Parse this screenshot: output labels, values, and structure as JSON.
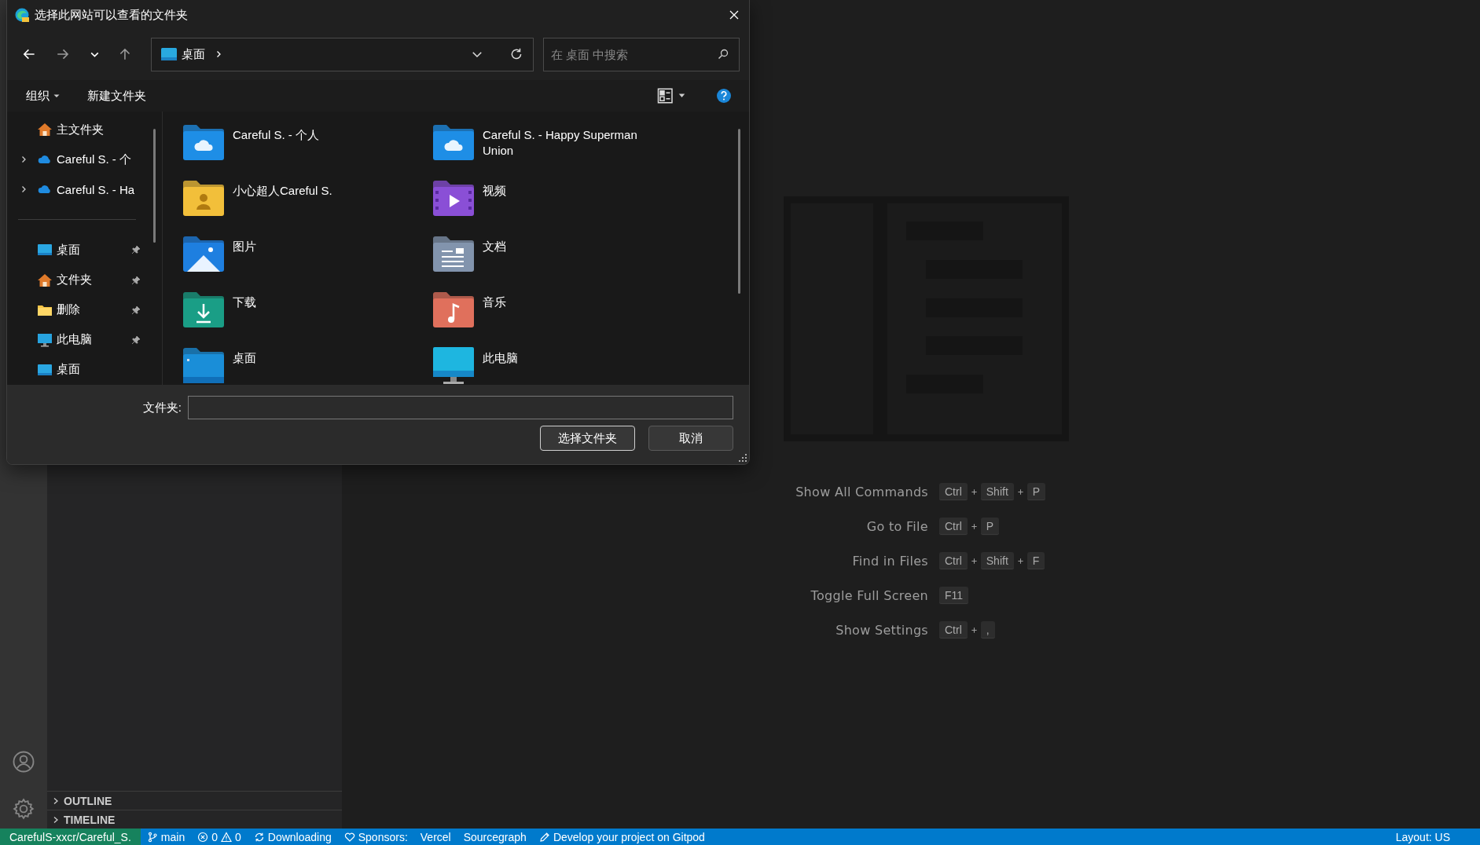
{
  "dialog": {
    "title": "选择此网站可以查看的文件夹",
    "address": {
      "location": "桌面"
    },
    "search": {
      "placeholder": "在 桌面 中搜索"
    },
    "toolbar": [
      "组织",
      "新建文件夹"
    ],
    "nav_pane": [
      {
        "label": "主文件夹",
        "kind": "home",
        "expandable": false,
        "pinned": false
      },
      {
        "label": "Careful S. - 个",
        "kind": "cloud",
        "expandable": true,
        "pinned": false
      },
      {
        "label": "Careful S. - Ha",
        "kind": "cloud",
        "expandable": true,
        "pinned": false
      },
      {
        "kind": "separator"
      },
      {
        "label": "桌面",
        "kind": "desktop",
        "expandable": false,
        "pinned": true
      },
      {
        "label": "文件夹",
        "kind": "home",
        "expandable": false,
        "pinned": true
      },
      {
        "label": "删除",
        "kind": "folder",
        "expandable": false,
        "pinned": true
      },
      {
        "label": "此电脑",
        "kind": "pc",
        "expandable": false,
        "pinned": true
      },
      {
        "label": "桌面",
        "kind": "desktop",
        "expandable": false,
        "pinned": false
      }
    ],
    "folders": [
      {
        "label": "Careful S. - 个人",
        "kind": "cloud"
      },
      {
        "label": "Careful S. - Happy Superman Union",
        "kind": "cloud"
      },
      {
        "label": "小心超人Careful S.",
        "kind": "user"
      },
      {
        "label": "视频",
        "kind": "video"
      },
      {
        "label": "图片",
        "kind": "pictures"
      },
      {
        "label": "文档",
        "kind": "documents"
      },
      {
        "label": "下载",
        "kind": "downloads"
      },
      {
        "label": "音乐",
        "kind": "music"
      },
      {
        "label": "桌面",
        "kind": "desktop"
      },
      {
        "label": "此电脑",
        "kind": "pc"
      }
    ],
    "folder_field": {
      "label": "文件夹:"
    },
    "buttons": [
      "选择文件夹",
      "取消"
    ]
  },
  "sidebar_sections": [
    {
      "label": "OUTLINE",
      "expanded": false
    },
    {
      "label": "TIMELINE",
      "expanded": false
    }
  ],
  "shortcuts": [
    {
      "label": "Show All Commands",
      "keys": [
        "Ctrl",
        "Shift",
        "P"
      ]
    },
    {
      "label": "Go to File",
      "keys": [
        "Ctrl",
        "P"
      ]
    },
    {
      "label": "Find in Files",
      "keys": [
        "Ctrl",
        "Shift",
        "F"
      ]
    },
    {
      "label": "Toggle Full Screen",
      "keys": [
        "F11"
      ]
    },
    {
      "label": "Show Settings",
      "keys": [
        "Ctrl",
        ","
      ]
    }
  ],
  "status_bar": {
    "remote": "CarefulS-xxcr/Careful_S.",
    "items": [
      {
        "kind": "branch",
        "text": "main"
      },
      {
        "kind": "problems",
        "errors": "0",
        "warnings": "0"
      },
      {
        "kind": "sync",
        "text": "Downloading"
      },
      {
        "kind": "heart",
        "text": "Sponsors:"
      },
      {
        "kind": "plain",
        "text": "Vercel"
      },
      {
        "kind": "plain",
        "text": "Sourcegraph"
      },
      {
        "kind": "pencil",
        "text": "Develop your project on Gitpod"
      }
    ],
    "right": "Layout: US"
  }
}
